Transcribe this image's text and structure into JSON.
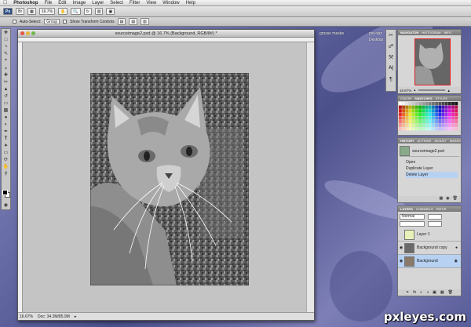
{
  "menubar": {
    "app": "Photoshop",
    "items": [
      "File",
      "Edit",
      "Image",
      "Layer",
      "Select",
      "Filter",
      "View",
      "Window",
      "Help"
    ]
  },
  "options_bar": {
    "zoom": "16.7%"
  },
  "tool_options": {
    "auto_select_label": "Auto-Select:",
    "auto_select_value": "Group",
    "transform_label": "Show Transform Controls"
  },
  "document": {
    "title": "sourceimage2.psd @ 16.7% (Background, RGB/8#) *",
    "status_zoom": "16.67%",
    "status_doc": "Doc: 34.3M/85.9M"
  },
  "navigator": {
    "tabs": [
      "NAVIGATOR",
      "HISTOGRAM",
      "INFO"
    ],
    "zoom": "16.67%"
  },
  "swatches": {
    "tabs": [
      "COLOR",
      "SWATCHES",
      "STYLES"
    ]
  },
  "history": {
    "tabs": [
      "HISTORY",
      "ACTIONS",
      "ADJUST",
      "MASKS"
    ],
    "snapshot": "sourceimage2.psd",
    "steps": [
      "Open",
      "Duplicate Layer",
      "Delete Layer"
    ],
    "active_step": 2
  },
  "layers": {
    "tabs": [
      "LAYERS",
      "CHANNELS",
      "PATHS"
    ],
    "blend_mode": "Normal",
    "items": [
      "Layer 1",
      "Background copy",
      "Background"
    ],
    "selected": 2
  },
  "desktop": {
    "labels": [
      "grosse maske",
      "pxv-wiz",
      "Desktop"
    ]
  },
  "watermark": "pxleyes.com",
  "colors": {
    "selection": "#b7d1f2",
    "panel_tab": "#7c7c7c"
  }
}
